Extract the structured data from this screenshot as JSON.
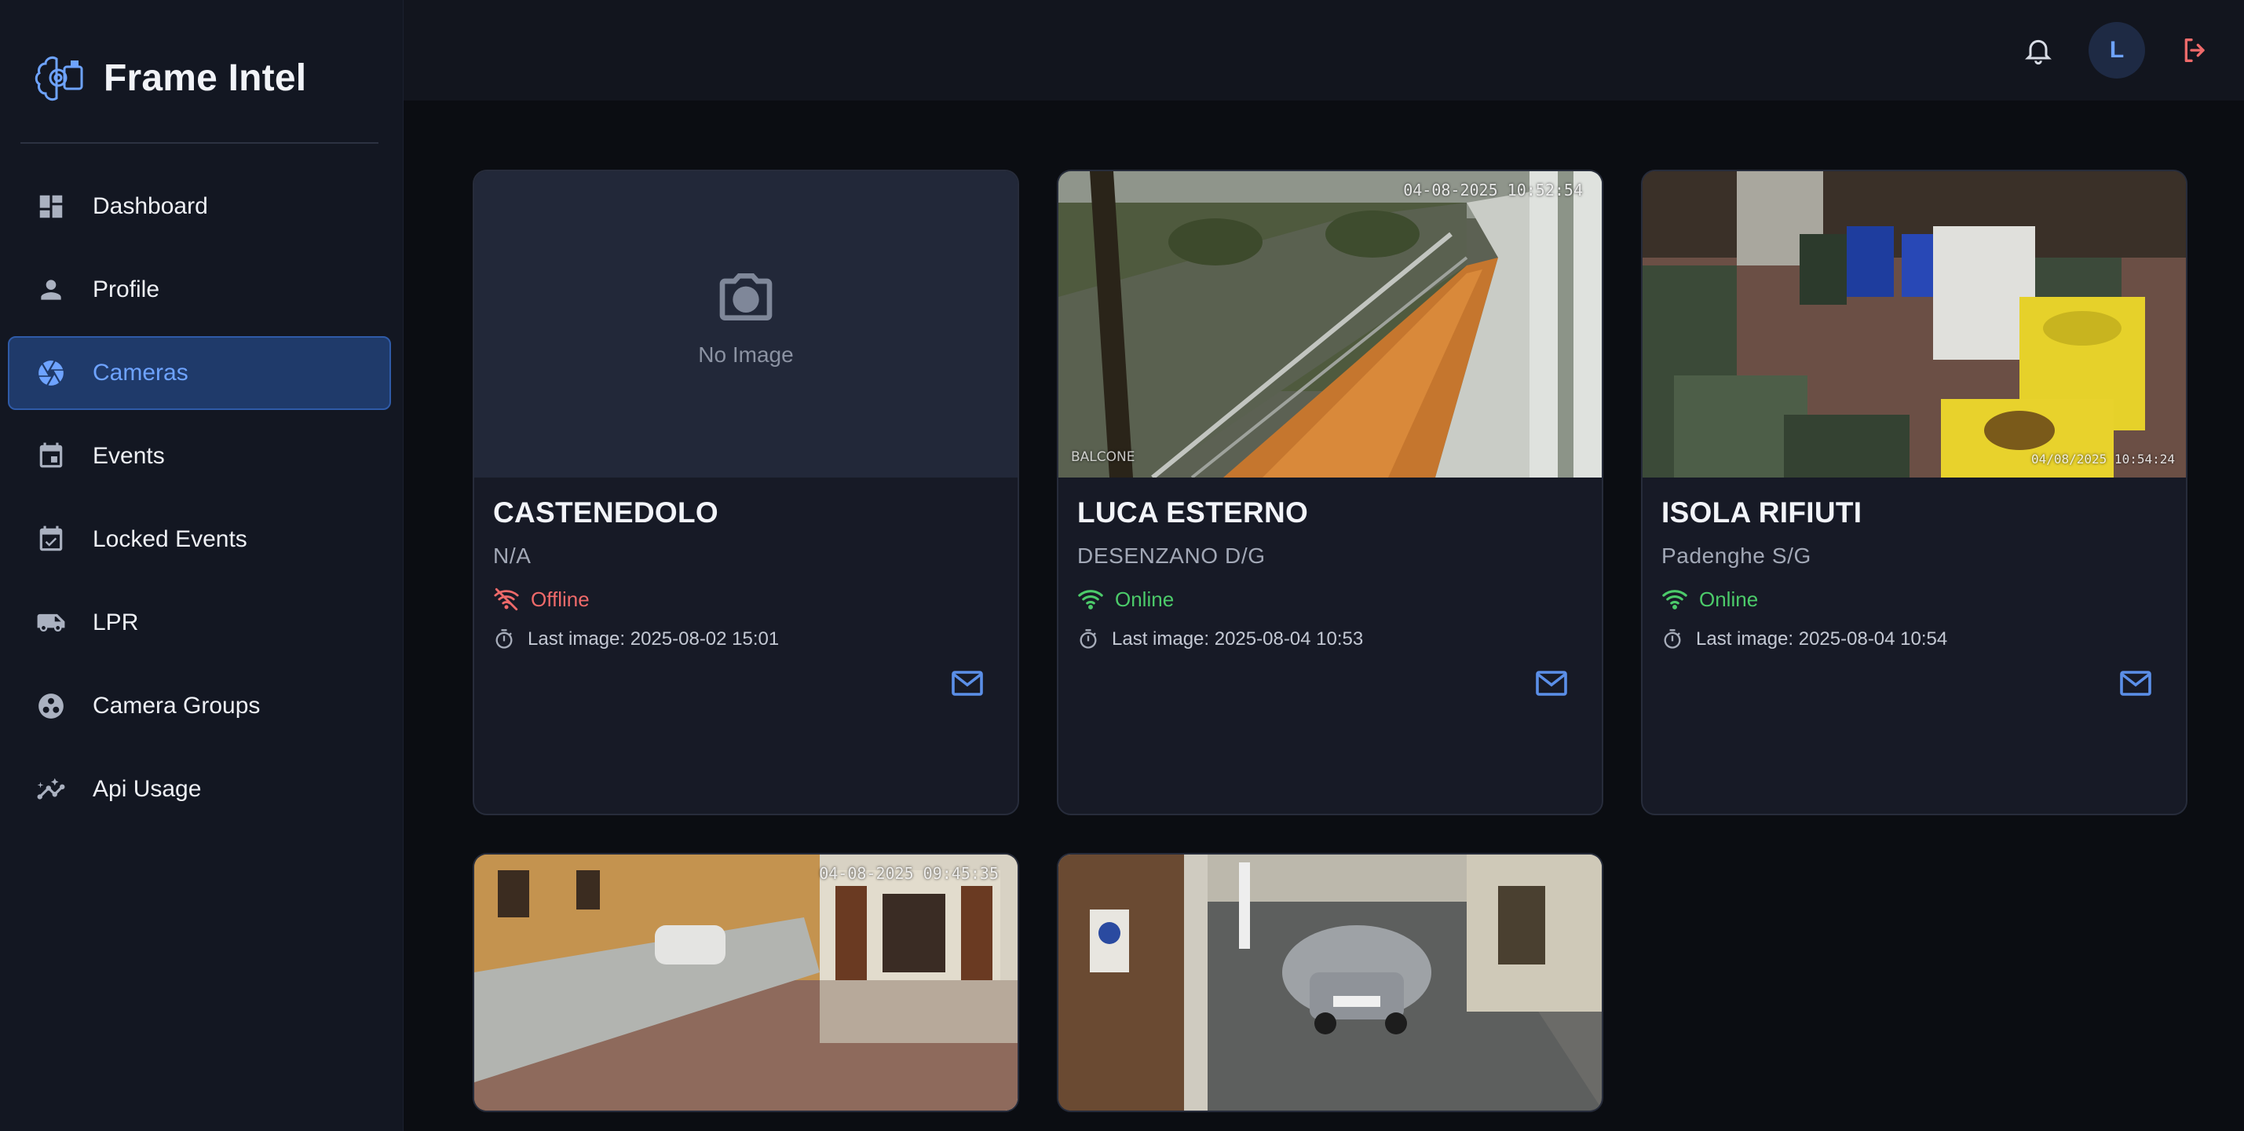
{
  "app": {
    "title": "Frame Intel"
  },
  "sidebar": {
    "items": [
      {
        "label": "Dashboard",
        "icon": "dashboard-icon"
      },
      {
        "label": "Profile",
        "icon": "person-icon"
      },
      {
        "label": "Cameras",
        "icon": "camera-shutter-icon",
        "active": true
      },
      {
        "label": "Events",
        "icon": "calendar-event-icon"
      },
      {
        "label": "Locked Events",
        "icon": "calendar-check-icon"
      },
      {
        "label": "LPR",
        "icon": "vehicle-icon"
      },
      {
        "label": "Camera Groups",
        "icon": "group-icon"
      },
      {
        "label": "Api Usage",
        "icon": "analytics-icon"
      }
    ]
  },
  "header": {
    "avatar_initial": "L"
  },
  "cameras": [
    {
      "name": "CASTENEDOLO",
      "location": "N/A",
      "status": "Offline",
      "last_image": "Last image: 2025-08-02 15:01",
      "thumbnail_text": "No Image"
    },
    {
      "name": "LUCA ESTERNO",
      "location": "DESENZANO D/G",
      "status": "Online",
      "last_image": "Last image: 2025-08-04 10:53",
      "stamp": "04-08-2025 10:52:54",
      "watermark": "BALCONE"
    },
    {
      "name": "ISOLA RIFIUTI",
      "location": "Padenghe S/G",
      "status": "Online",
      "last_image": "Last image: 2025-08-04 10:54",
      "stamp": "04/08/2025 10:54:24"
    },
    {
      "stamp": "04-08-2025 09:45:35"
    },
    {
      "stamp": ""
    }
  ],
  "colors": {
    "accent": "#6ea3ff",
    "online": "#4ccb6a",
    "offline": "#ef6a6a",
    "logout": "#ef6a6a"
  }
}
